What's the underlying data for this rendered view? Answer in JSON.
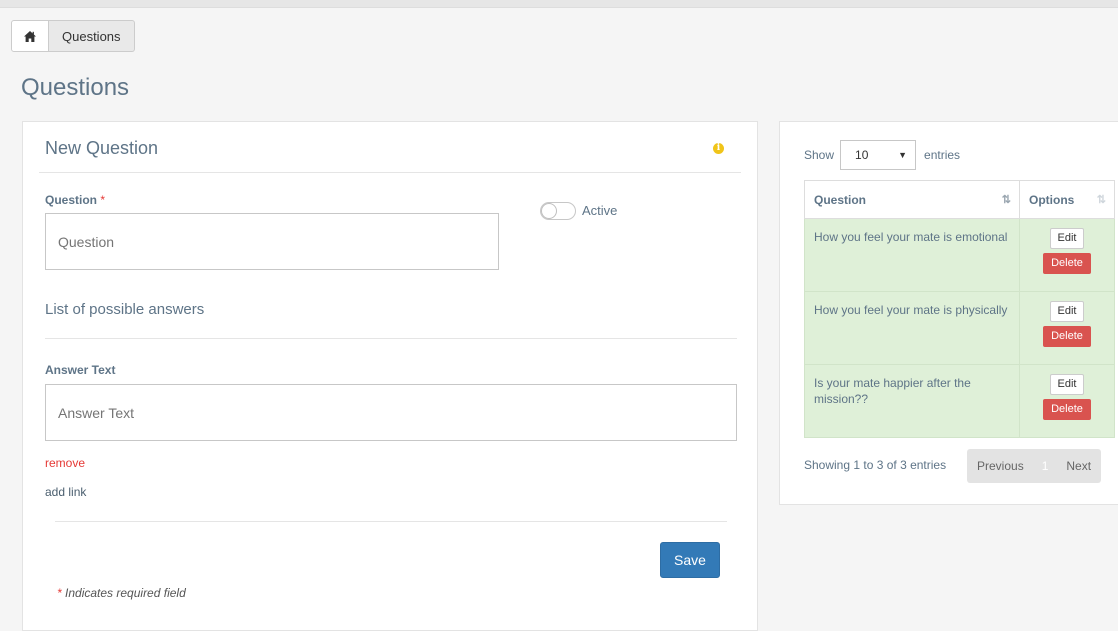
{
  "breadcrumb": {
    "current": "Questions"
  },
  "page": {
    "title": "Questions"
  },
  "form": {
    "title": "New Question",
    "question_label": "Question",
    "required_mark": "*",
    "question_placeholder": "Question",
    "active_label": "Active",
    "active_on": false,
    "answers_heading": "List of possible answers",
    "answer_label": "Answer Text",
    "answer_placeholder": "Answer Text",
    "remove_link": "remove",
    "add_link": "add link",
    "save_label": "Save",
    "required_note": "Indicates required field"
  },
  "table": {
    "show_label": "Show",
    "page_size": "10",
    "entries_label": "entries",
    "columns": [
      "Question",
      "Options"
    ],
    "rows": [
      {
        "question": "How you feel your mate is emotional",
        "edit": "Edit",
        "delete": "Delete"
      },
      {
        "question": "How you feel your mate is physically",
        "edit": "Edit",
        "delete": "Delete"
      },
      {
        "question": "Is your mate happier after the mission??",
        "edit": "Edit",
        "delete": "Delete"
      }
    ],
    "info": "Showing 1 to 3 of 3 entries",
    "prev_label": "Previous",
    "current_page": "1",
    "next_label": "Next"
  },
  "colors": {
    "accent": "#337ab7",
    "danger": "#d9534f",
    "row_bg": "#dff0d8",
    "heading": "#5e7487",
    "info_icon": "#f0c419"
  }
}
